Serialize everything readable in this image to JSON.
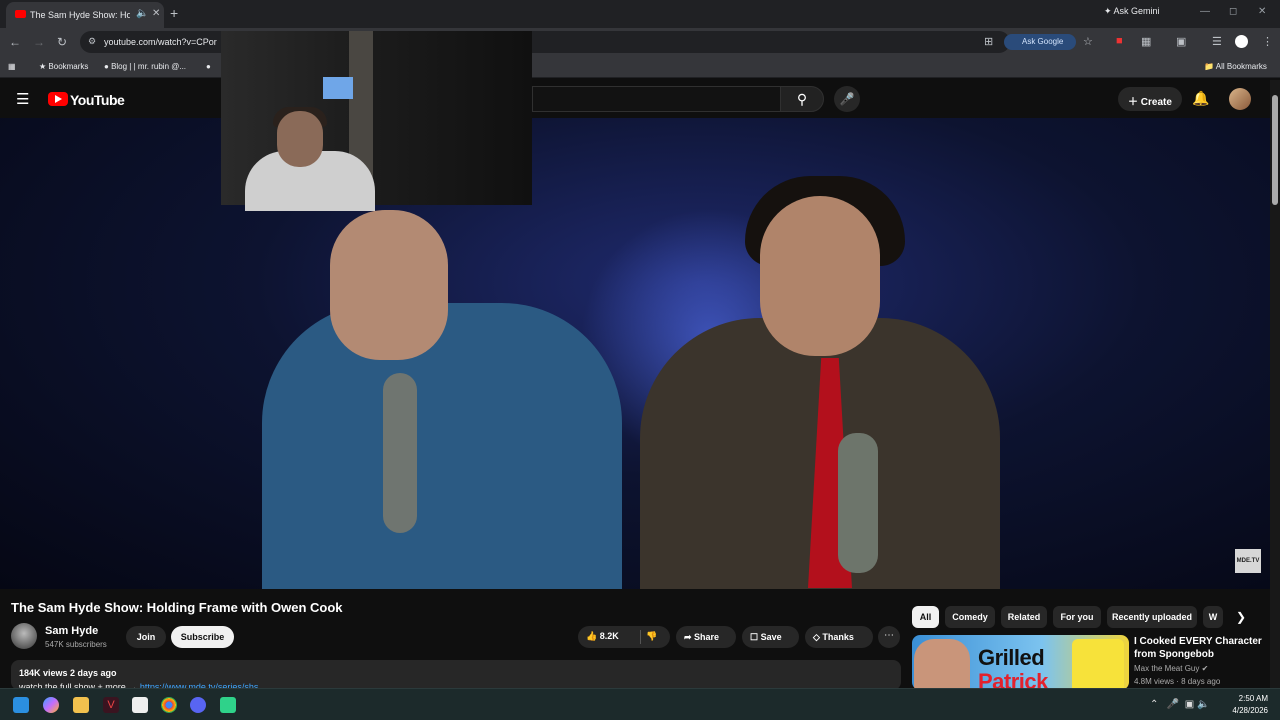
{
  "browser": {
    "tab_title": "The Sam Hyde Show: Holdi",
    "new_tab_glyph": "+",
    "ask_gemini": "Ask Gemini",
    "url": "youtube.com/watch?v=CPor",
    "ask_google": "Ask Google",
    "bookmarks": [
      "Bookmarks",
      "Blog | | mr. rubin @..."
    ],
    "all_bookmarks": "All Bookmarks"
  },
  "youtube": {
    "logo_text": "YouTube",
    "create_label": "Create",
    "watermark": "MDE.TV"
  },
  "video": {
    "title": "The Sam Hyde Show: Holding Frame with Owen Cook",
    "channel_name": "Sam Hyde",
    "subscribers": "547K subscribers",
    "join_label": "Join",
    "subscribe_label": "Subscribe",
    "likes": "8.2K",
    "share_label": "Share",
    "save_label": "Save",
    "thanks_label": "Thanks",
    "views_date": "184K views  2 days ago",
    "description_text": "watch the full show + more → ",
    "description_link": "https://www.mde.tv/series/shs"
  },
  "chips": [
    "All",
    "Comedy",
    "Related",
    "For you",
    "Recently uploaded",
    "W"
  ],
  "recommendation": {
    "thumb_line1": "Grilled",
    "thumb_line2": "Patrick",
    "title": "I Cooked EVERY Character from Spongebob",
    "channel": "Max the Meat Guy ✔",
    "meta": "4.8M views · 8 days ago"
  },
  "taskbar": {
    "time": "2:50 AM",
    "date": "4/28/2026"
  },
  "colors": {
    "youtube_red": "#ff0000",
    "link_blue": "#3ea6ff",
    "background": "#0f0f0f"
  }
}
